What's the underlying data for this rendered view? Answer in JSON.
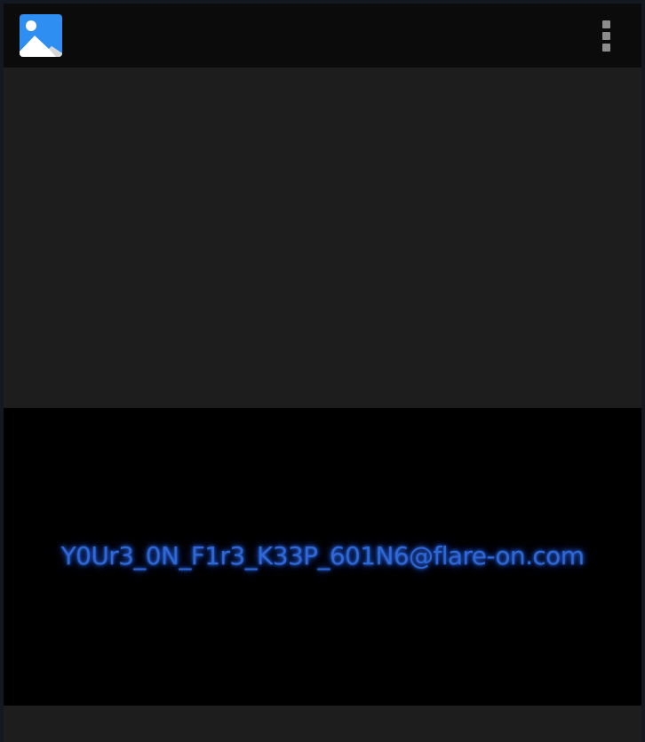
{
  "app_bar": {
    "app_icon": "gallery-image-icon",
    "menu_icon": "more-vert-icon"
  },
  "display": {
    "text": "Y0Ur3_0N_F1r3_K33P_601N6@flare-on.com",
    "text_color": "#2e69d6"
  },
  "colors": {
    "app_bar_bg": "#0b0b0b",
    "surface_bg": "#1d1d1d",
    "panel_bg": "#000000",
    "icon_blue": "#2f8ef2"
  }
}
